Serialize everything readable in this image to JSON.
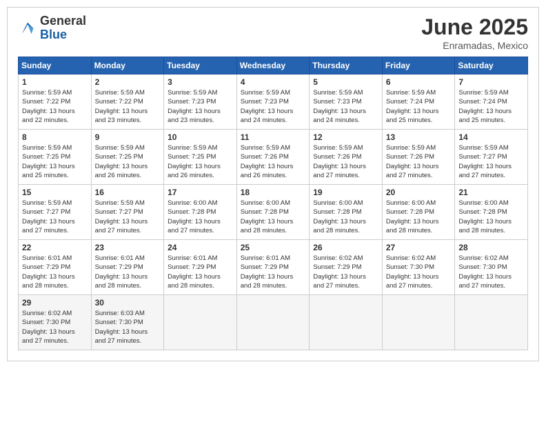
{
  "logo": {
    "general": "General",
    "blue": "Blue"
  },
  "title": "June 2025",
  "subtitle": "Enramadas, Mexico",
  "days_header": [
    "Sunday",
    "Monday",
    "Tuesday",
    "Wednesday",
    "Thursday",
    "Friday",
    "Saturday"
  ],
  "weeks": [
    [
      {
        "day": "1",
        "sunrise": "5:59 AM",
        "sunset": "7:22 PM",
        "daylight": "13 hours and 22 minutes."
      },
      {
        "day": "2",
        "sunrise": "5:59 AM",
        "sunset": "7:22 PM",
        "daylight": "13 hours and 23 minutes."
      },
      {
        "day": "3",
        "sunrise": "5:59 AM",
        "sunset": "7:23 PM",
        "daylight": "13 hours and 23 minutes."
      },
      {
        "day": "4",
        "sunrise": "5:59 AM",
        "sunset": "7:23 PM",
        "daylight": "13 hours and 24 minutes."
      },
      {
        "day": "5",
        "sunrise": "5:59 AM",
        "sunset": "7:23 PM",
        "daylight": "13 hours and 24 minutes."
      },
      {
        "day": "6",
        "sunrise": "5:59 AM",
        "sunset": "7:24 PM",
        "daylight": "13 hours and 25 minutes."
      },
      {
        "day": "7",
        "sunrise": "5:59 AM",
        "sunset": "7:24 PM",
        "daylight": "13 hours and 25 minutes."
      }
    ],
    [
      {
        "day": "8",
        "sunrise": "5:59 AM",
        "sunset": "7:25 PM",
        "daylight": "13 hours and 25 minutes."
      },
      {
        "day": "9",
        "sunrise": "5:59 AM",
        "sunset": "7:25 PM",
        "daylight": "13 hours and 26 minutes."
      },
      {
        "day": "10",
        "sunrise": "5:59 AM",
        "sunset": "7:25 PM",
        "daylight": "13 hours and 26 minutes."
      },
      {
        "day": "11",
        "sunrise": "5:59 AM",
        "sunset": "7:26 PM",
        "daylight": "13 hours and 26 minutes."
      },
      {
        "day": "12",
        "sunrise": "5:59 AM",
        "sunset": "7:26 PM",
        "daylight": "13 hours and 27 minutes."
      },
      {
        "day": "13",
        "sunrise": "5:59 AM",
        "sunset": "7:26 PM",
        "daylight": "13 hours and 27 minutes."
      },
      {
        "day": "14",
        "sunrise": "5:59 AM",
        "sunset": "7:27 PM",
        "daylight": "13 hours and 27 minutes."
      }
    ],
    [
      {
        "day": "15",
        "sunrise": "5:59 AM",
        "sunset": "7:27 PM",
        "daylight": "13 hours and 27 minutes."
      },
      {
        "day": "16",
        "sunrise": "5:59 AM",
        "sunset": "7:27 PM",
        "daylight": "13 hours and 27 minutes."
      },
      {
        "day": "17",
        "sunrise": "6:00 AM",
        "sunset": "7:28 PM",
        "daylight": "13 hours and 27 minutes."
      },
      {
        "day": "18",
        "sunrise": "6:00 AM",
        "sunset": "7:28 PM",
        "daylight": "13 hours and 28 minutes."
      },
      {
        "day": "19",
        "sunrise": "6:00 AM",
        "sunset": "7:28 PM",
        "daylight": "13 hours and 28 minutes."
      },
      {
        "day": "20",
        "sunrise": "6:00 AM",
        "sunset": "7:28 PM",
        "daylight": "13 hours and 28 minutes."
      },
      {
        "day": "21",
        "sunrise": "6:00 AM",
        "sunset": "7:28 PM",
        "daylight": "13 hours and 28 minutes."
      }
    ],
    [
      {
        "day": "22",
        "sunrise": "6:01 AM",
        "sunset": "7:29 PM",
        "daylight": "13 hours and 28 minutes."
      },
      {
        "day": "23",
        "sunrise": "6:01 AM",
        "sunset": "7:29 PM",
        "daylight": "13 hours and 28 minutes."
      },
      {
        "day": "24",
        "sunrise": "6:01 AM",
        "sunset": "7:29 PM",
        "daylight": "13 hours and 28 minutes."
      },
      {
        "day": "25",
        "sunrise": "6:01 AM",
        "sunset": "7:29 PM",
        "daylight": "13 hours and 28 minutes."
      },
      {
        "day": "26",
        "sunrise": "6:02 AM",
        "sunset": "7:29 PM",
        "daylight": "13 hours and 27 minutes."
      },
      {
        "day": "27",
        "sunrise": "6:02 AM",
        "sunset": "7:30 PM",
        "daylight": "13 hours and 27 minutes."
      },
      {
        "day": "28",
        "sunrise": "6:02 AM",
        "sunset": "7:30 PM",
        "daylight": "13 hours and 27 minutes."
      }
    ],
    [
      {
        "day": "29",
        "sunrise": "6:02 AM",
        "sunset": "7:30 PM",
        "daylight": "13 hours and 27 minutes."
      },
      {
        "day": "30",
        "sunrise": "6:03 AM",
        "sunset": "7:30 PM",
        "daylight": "13 hours and 27 minutes."
      },
      null,
      null,
      null,
      null,
      null
    ]
  ],
  "labels": {
    "sunrise": "Sunrise:",
    "sunset": "Sunset:",
    "daylight": "Daylight:"
  }
}
